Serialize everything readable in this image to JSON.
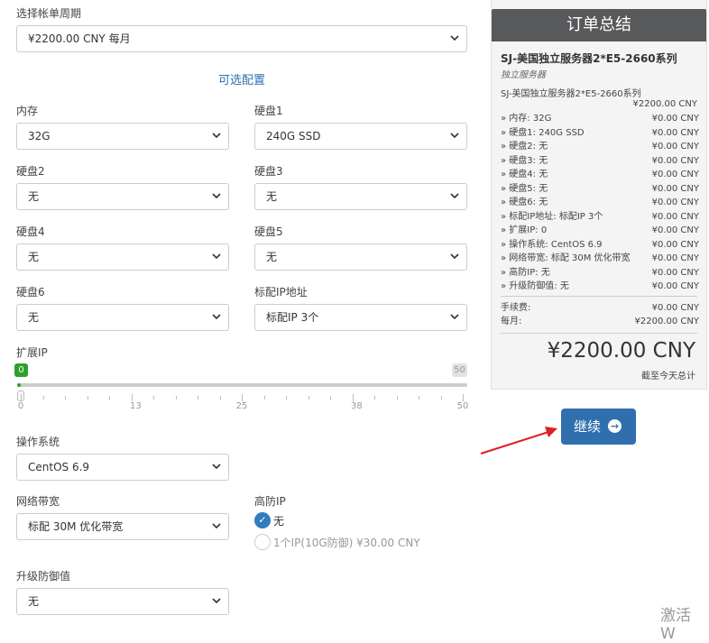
{
  "billing": {
    "label": "选择帐单周期",
    "value": "¥2200.00 CNY 每月"
  },
  "config_title": "可选配置",
  "fields": {
    "memory": {
      "label": "内存",
      "value": "32G"
    },
    "disk1": {
      "label": "硬盘1",
      "value": "240G SSD"
    },
    "disk2": {
      "label": "硬盘2",
      "value": "无"
    },
    "disk3": {
      "label": "硬盘3",
      "value": "无"
    },
    "disk4": {
      "label": "硬盘4",
      "value": "无"
    },
    "disk5": {
      "label": "硬盘5",
      "value": "无"
    },
    "disk6": {
      "label": "硬盘6",
      "value": "无"
    },
    "ip": {
      "label": "标配IP地址",
      "value": "标配IP 3个"
    },
    "os": {
      "label": "操作系统",
      "value": "CentOS 6.9"
    },
    "bandwidth": {
      "label": "网络带宽",
      "value": "标配 30M 优化带宽"
    },
    "defense": {
      "label": "升级防御值",
      "value": "无"
    }
  },
  "ext_ip": {
    "label": "扩展IP",
    "value": 0,
    "min": 0,
    "max": 50,
    "current_label": "0",
    "max_label": "50",
    "ticks": [
      "0",
      "13",
      "25",
      "38",
      "50"
    ]
  },
  "ddos_ip": {
    "label": "高防IP",
    "options": [
      {
        "label": "无",
        "checked": true
      },
      {
        "label": "1个IP(10G防御) ¥30.00 CNY",
        "checked": false
      }
    ]
  },
  "summary": {
    "title": "订单总结",
    "product": "SJ-美国独立服务器2*E5-2660系列",
    "group": "独立服务器",
    "line": "SJ-美国独立服务器2*E5-2660系列",
    "base_price": "¥2200.00 CNY",
    "items": [
      {
        "k": "» 内存: 32G",
        "v": "¥0.00 CNY"
      },
      {
        "k": "» 硬盘1: 240G SSD",
        "v": "¥0.00 CNY"
      },
      {
        "k": "» 硬盘2: 无",
        "v": "¥0.00 CNY"
      },
      {
        "k": "» 硬盘3: 无",
        "v": "¥0.00 CNY"
      },
      {
        "k": "» 硬盘4: 无",
        "v": "¥0.00 CNY"
      },
      {
        "k": "» 硬盘5: 无",
        "v": "¥0.00 CNY"
      },
      {
        "k": "» 硬盘6: 无",
        "v": "¥0.00 CNY"
      },
      {
        "k": "» 标配IP地址: 标配IP 3个",
        "v": "¥0.00 CNY"
      },
      {
        "k": "» 扩展IP: 0",
        "v": "¥0.00 CNY"
      },
      {
        "k": "» 操作系统: CentOS 6.9",
        "v": "¥0.00 CNY"
      },
      {
        "k": "» 网络带宽: 标配 30M 优化带宽",
        "v": "¥0.00 CNY"
      },
      {
        "k": "» 高防IP: 无",
        "v": "¥0.00 CNY"
      },
      {
        "k": "» 升级防御值: 无",
        "v": "¥0.00 CNY"
      }
    ],
    "fee_label": "手续费:",
    "fee": "¥0.00 CNY",
    "monthly_label": "每月:",
    "monthly": "¥2200.00 CNY",
    "total": "¥2200.00 CNY",
    "total_note": "截至今天总计"
  },
  "continue_label": "继续",
  "activate_text": "激活 W",
  "colors": {
    "primary": "#2f6fae",
    "slider": "#2ca02c",
    "header": "#58595b",
    "arrow": "#e02020"
  }
}
